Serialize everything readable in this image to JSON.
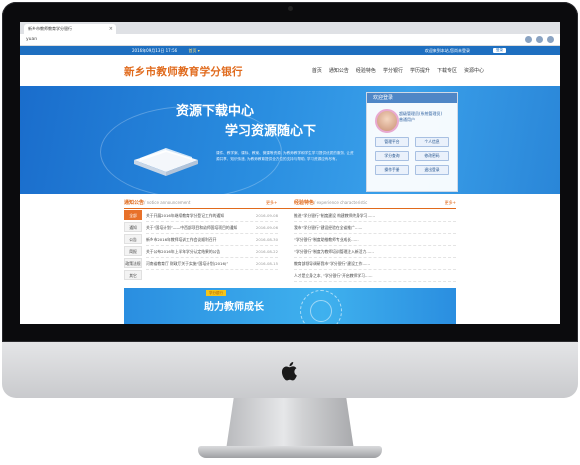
{
  "browser": {
    "tab_title": "新乡市教师教育学分银行",
    "tab_close": "×",
    "address": "yuan"
  },
  "topstrip": {
    "date_text": "2016年09月13日 17:56",
    "region_select": "首页 ▾",
    "welcome": "欢迎来到本站,您尚未登录",
    "button": "登录"
  },
  "header": {
    "logo": "新乡市教师教育学分银行",
    "nav": [
      "首页",
      "通知公告",
      "经验特色",
      "学分银行",
      "学历提升",
      "下载专区",
      "资源中心"
    ]
  },
  "banner": {
    "title_line1": "资源下载中心",
    "title_line2": "学习资源随心下",
    "description": "课件、教学案、课标、教案、微课等资源, 为教师教学和学生学习提供优质的服务, 让资源共享、知识传递, 为教师教育提供全方位的支持与帮助, 学习资源应有尽有。"
  },
  "login_panel": {
    "heading": "欢迎登录",
    "user_name": "超级管理员(系统管理员)",
    "user_role": "普通用户",
    "buttons": [
      "管理平台",
      "个人信息",
      "学分查询",
      "修改密码",
      "操作手册",
      "退出登录"
    ]
  },
  "notice_section": {
    "title": "通知公告",
    "title_en": "/ notice announcement",
    "more": "更多+",
    "side_tabs": [
      "全部",
      "通知",
      "公告",
      "简报",
      "政策法规",
      "其它"
    ],
    "items": [
      {
        "text": "关于开展2016年继续教育学分登记工作的通知",
        "date": "2016-09-08"
      },
      {
        "text": "关于“国培计划”——中西部项目和幼师国培项目的通知",
        "date": "2016-09-06"
      },
      {
        "text": "新乡市2016年教师培训工作会议顺利召开",
        "date": "2016-08-30"
      },
      {
        "text": "关于公布2016年上半年学分认定结果的公告",
        "date": "2016-08-22"
      },
      {
        "text": "河南省教育厅 财政厅关于实施“国培计划(2016)”",
        "date": "2016-08-15"
      }
    ]
  },
  "experience_section": {
    "title": "经验特色",
    "title_en": "/ experience characteristic",
    "more": "更多+",
    "items": [
      {
        "text": "推进“学分银行”制度建设 构建教师终身学习……",
        "date": ""
      },
      {
        "text": "我市“学分银行”建设经验在全省推广……",
        "date": ""
      },
      {
        "text": "“学分银行”制度助推教师专业成长……",
        "date": ""
      },
      {
        "text": "“学分银行”制度为教师培训管理注入新活力……",
        "date": ""
      },
      {
        "text": "教育部领导调研我市“学分银行”建设工作……",
        "date": ""
      },
      {
        "text": "人才是立身之本, “学分银行”开启教师学习……",
        "date": ""
      }
    ]
  },
  "promo": {
    "tag": "学分银行",
    "text": "助力教师成长"
  },
  "colors": {
    "brand_orange": "#e06a1c",
    "brand_blue": "#1e6fc0",
    "banner_blue": "#2a8ee0"
  },
  "icons": [
    "apple-logo-icon",
    "camera-icon",
    "book-icon",
    "avatar-icon"
  ]
}
